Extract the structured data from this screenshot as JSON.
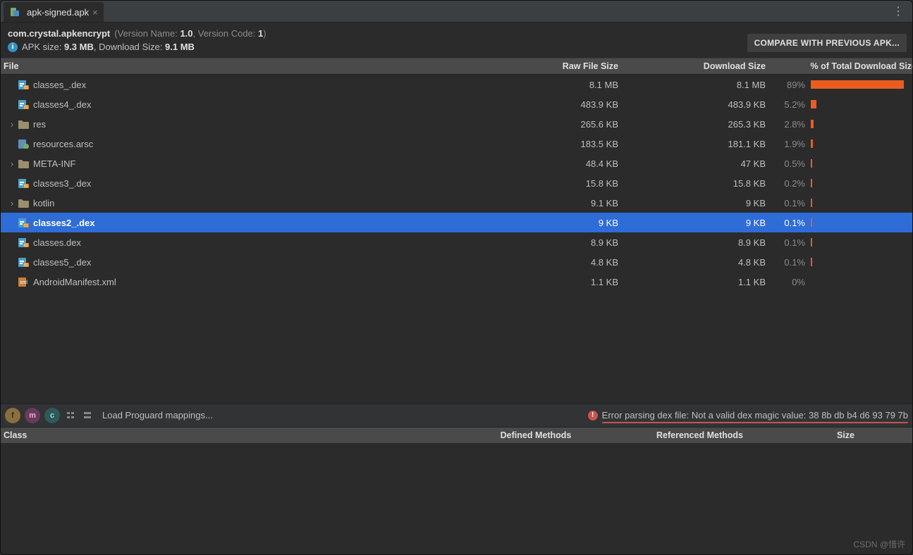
{
  "tab": {
    "title": "apk-signed.apk"
  },
  "package": {
    "id": "com.crystal.apkencrypt",
    "version_name_label": "(Version Name: ",
    "version_name": "1.0",
    "version_sep": ", Version Code: ",
    "version_code": "1",
    "version_close": ")"
  },
  "sizes": {
    "apk_label": "APK size: ",
    "apk_value": "9.3 MB",
    "dl_label": ", Download Size: ",
    "dl_value": "9.1 MB"
  },
  "compare_button": "COMPARE WITH PREVIOUS APK...",
  "columns": {
    "file": "File",
    "raw": "Raw File Size",
    "download": "Download Size",
    "pct": "% of Total Download Size"
  },
  "files": [
    {
      "name": "classes_.dex",
      "raw": "8.1 MB",
      "dl": "8.1 MB",
      "pct": "89%",
      "bar": 89,
      "icon": "dex",
      "expandable": false
    },
    {
      "name": "classes4_.dex",
      "raw": "483.9 KB",
      "dl": "483.9 KB",
      "pct": "5.2%",
      "bar": 5.2,
      "icon": "dex",
      "expandable": false
    },
    {
      "name": "res",
      "raw": "265.6 KB",
      "dl": "265.3 KB",
      "pct": "2.8%",
      "bar": 2.8,
      "icon": "folder",
      "expandable": true
    },
    {
      "name": "resources.arsc",
      "raw": "183.5 KB",
      "dl": "181.1 KB",
      "pct": "1.9%",
      "bar": 1.9,
      "icon": "arsc",
      "expandable": false
    },
    {
      "name": "META-INF",
      "raw": "48.4 KB",
      "dl": "47 KB",
      "pct": "0.5%",
      "bar": 0.5,
      "icon": "folder",
      "expandable": true
    },
    {
      "name": "classes3_.dex",
      "raw": "15.8 KB",
      "dl": "15.8 KB",
      "pct": "0.2%",
      "bar": 0.2,
      "icon": "dex",
      "expandable": false
    },
    {
      "name": "kotlin",
      "raw": "9.1 KB",
      "dl": "9 KB",
      "pct": "0.1%",
      "bar": 0.1,
      "icon": "folder",
      "expandable": true
    },
    {
      "name": "classes2_.dex",
      "raw": "9 KB",
      "dl": "9 KB",
      "pct": "0.1%",
      "bar": 0.1,
      "icon": "dex",
      "expandable": false,
      "selected": true
    },
    {
      "name": "classes.dex",
      "raw": "8.9 KB",
      "dl": "8.9 KB",
      "pct": "0.1%",
      "bar": 0.1,
      "icon": "dex",
      "expandable": false
    },
    {
      "name": "classes5_.dex",
      "raw": "4.8 KB",
      "dl": "4.8 KB",
      "pct": "0.1%",
      "bar": 0.1,
      "icon": "dex",
      "expandable": false
    },
    {
      "name": "AndroidManifest.xml",
      "raw": "1.1 KB",
      "dl": "1.1 KB",
      "pct": "0%",
      "bar": 0,
      "icon": "xml",
      "expandable": false
    }
  ],
  "toolbar": {
    "proguard": "Load Proguard mappings...",
    "circles": {
      "f": "f",
      "m": "m",
      "c": "c"
    }
  },
  "error": "Error parsing dex file: Not a valid dex magic value: 38 8b db b4 d6 93 79 7b",
  "class_columns": {
    "class": "Class",
    "defined": "Defined Methods",
    "referenced": "Referenced Methods",
    "size": "Size"
  },
  "watermark": "CSDN @惜许"
}
